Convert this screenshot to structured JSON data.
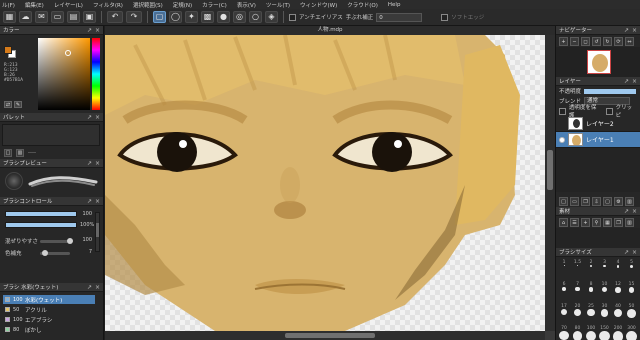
{
  "menu": [
    "ル(F)",
    "編集(E)",
    "レイヤー(L)",
    "フィルタ(R)",
    "選択範囲(S)",
    "定規(N)",
    "カラー(C)",
    "表示(V)",
    "ツール(T)",
    "ウィンドウ(W)",
    "クラウド(O)",
    "Help"
  ],
  "toolbar": {
    "antialias_label": "アンチエイリアス",
    "stabilizer_label": "手ぶれ補正",
    "stabilizer_value": "0",
    "soft_edge_label": "ソフトエッジ"
  },
  "color": {
    "title": "カラー",
    "rgb_lines": [
      "R:213",
      "G:123",
      "B:26",
      "#D57B1A"
    ]
  },
  "palette": {
    "title": "パレット",
    "name": "----"
  },
  "brush_preview": {
    "title": "ブラシプレビュー"
  },
  "brush_control": {
    "title": "ブラシコントロール",
    "size_value": "100",
    "opacity_value": "100%",
    "blend_label": "混ぜりやすさ",
    "blend_value": "100",
    "correction_label": "色補充",
    "correction_value": "7",
    "size_fraction": 1.0,
    "opacity_fraction": 1.0,
    "blend_fraction": 1.0,
    "correction_fraction": 0.07
  },
  "brush_list": {
    "title": "ブラシ 水彩(ウェット)",
    "items": [
      {
        "num": "100",
        "name": "水彩(ウェット)",
        "selected": true
      },
      {
        "num": "50",
        "name": "アクリル",
        "selected": false
      },
      {
        "num": "100",
        "name": "エアブラシ",
        "selected": false
      },
      {
        "num": "80",
        "name": "ぼかし",
        "selected": false
      }
    ]
  },
  "canvas": {
    "title": "人物.mdp"
  },
  "navigator": {
    "title": "ナビゲーター"
  },
  "layers": {
    "title": "レイヤー",
    "opacity_label": "不透明度",
    "blend_label": "ブレンド",
    "blend_value": "通常",
    "protect_label": "透明度を保護",
    "clipping_label": "クリッピ",
    "items": [
      {
        "name": "レイヤー2",
        "selected": false
      },
      {
        "name": "レイヤー1",
        "selected": true
      }
    ]
  },
  "material": {
    "title": "素材"
  },
  "brush_size": {
    "title": "ブラシサイズ",
    "labels": [
      "1",
      "1.5",
      "2",
      "3",
      "4",
      "5",
      "6",
      "7",
      "8",
      "10",
      "12",
      "15",
      "17",
      "20",
      "25",
      "30",
      "40",
      "50",
      "70",
      "80",
      "100",
      "150",
      "200",
      "300"
    ]
  }
}
